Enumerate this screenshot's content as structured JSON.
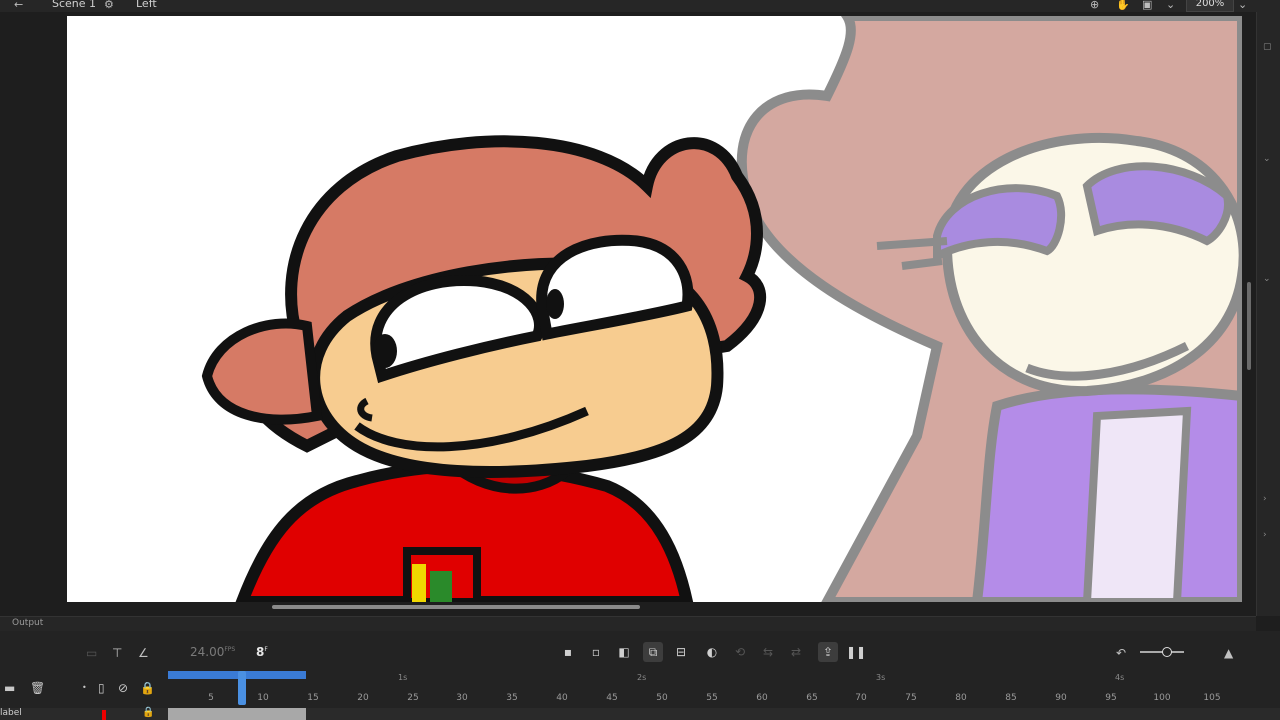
{
  "header": {
    "back_icon": "arrow-left-icon",
    "scene_label": "Scene 1",
    "symbol_label": "Left",
    "zoom_value": "200%"
  },
  "output_panel": {
    "title": "Output"
  },
  "timeline": {
    "fps_value": "24.00",
    "fps_unit": "FPS",
    "current_frame": "8",
    "frame_unit": "F",
    "ruler_ticks": [
      "5",
      "10",
      "15",
      "20",
      "25",
      "30",
      "35",
      "40",
      "45",
      "50",
      "55",
      "60",
      "65",
      "70",
      "75",
      "80",
      "85",
      "90",
      "95",
      "100",
      "105"
    ],
    "second_marks": [
      "1s",
      "2s",
      "3s",
      "4s"
    ],
    "layers": [
      {
        "name": "label",
        "color": "#e00000"
      }
    ]
  }
}
